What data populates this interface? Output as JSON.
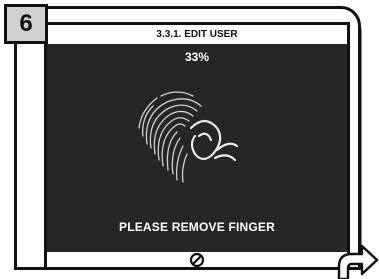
{
  "step": {
    "number": "6"
  },
  "screen": {
    "title": "3.3.1. EDIT USER",
    "progress_text": "33%",
    "progress_value": 0.33,
    "message": "PLEASE REMOVE FINGER"
  },
  "icons": {
    "fingerprint": "fingerprint-icon",
    "footer": "no-entry-icon",
    "arrow": "curved-arrow-icon"
  },
  "colors": {
    "display_background": "#262626",
    "badge_background": "#d0d0d0",
    "frame": "#111111",
    "text_on_display": "#ffffff"
  }
}
